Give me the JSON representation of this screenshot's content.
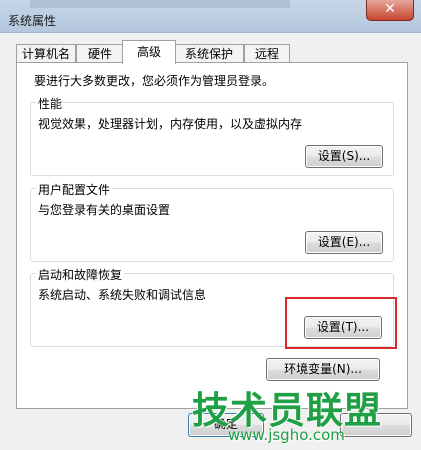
{
  "window": {
    "title": "系统属性",
    "close_glyph": "✕"
  },
  "tabs": [
    "计算机名",
    "硬件",
    "高级",
    "系统保护",
    "远程"
  ],
  "active_tab": "高级",
  "notice": "要进行大多数更改，您必须作为管理员登录。",
  "performance": {
    "title": "性能",
    "description": "视觉效果，处理器计划，内存使用，以及虚拟内存",
    "button": "设置(S)..."
  },
  "user_profiles": {
    "title": "用户配置文件",
    "description": "与您登录有关的桌面设置",
    "button": "设置(E)..."
  },
  "startup_recovery": {
    "title": "启动和故障恢复",
    "description": "系统启动、系统失败和调试信息",
    "button": "设置(T)..."
  },
  "env_button": "环境变量(N)...",
  "ok_button": "确定",
  "watermark": {
    "text": "技术员联盟",
    "url": "www.jsgho.com"
  },
  "colors": {
    "highlight": "#d9292c",
    "watermark": "#1fa045"
  }
}
